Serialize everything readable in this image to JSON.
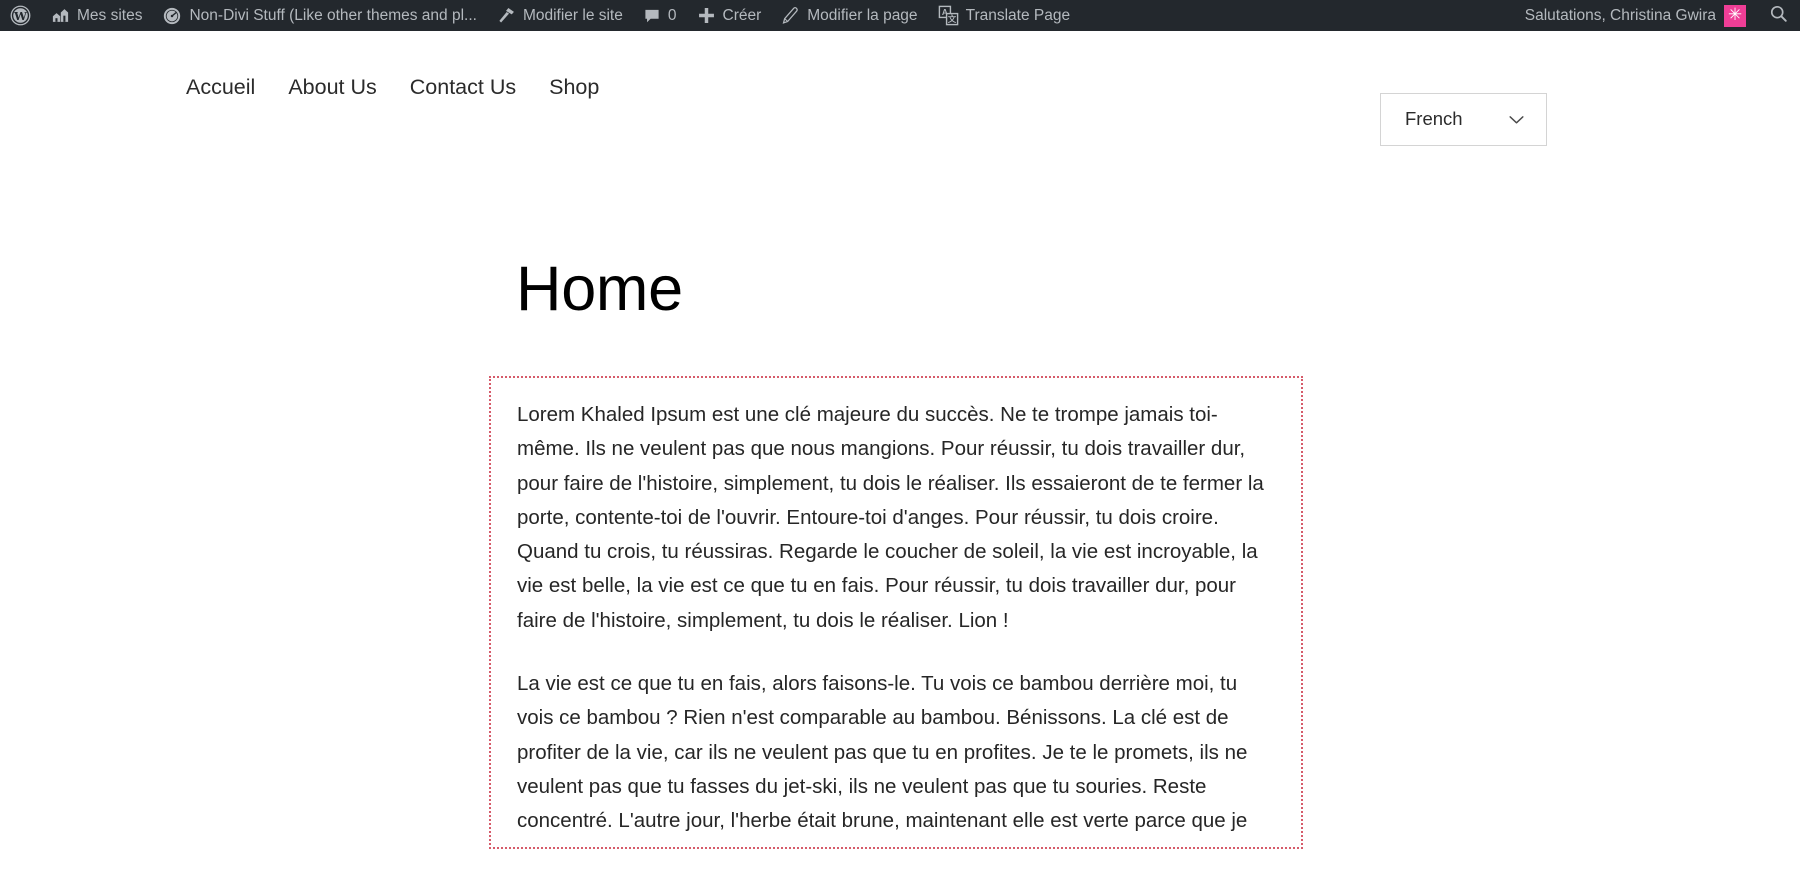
{
  "admin_bar": {
    "items": [
      {
        "name": "wp-logo",
        "icon": "wordpress-icon",
        "label": ""
      },
      {
        "name": "my-sites",
        "icon": "buildings-icon",
        "label": "Mes sites"
      },
      {
        "name": "site-name",
        "icon": "dashboard-icon",
        "label": "Non-Divi Stuff (Like other themes and pl..."
      },
      {
        "name": "customize",
        "icon": "hammer-icon",
        "label": "Modifier le site"
      },
      {
        "name": "comments",
        "icon": "comment-bubble-icon",
        "label": "0"
      },
      {
        "name": "new-content",
        "icon": "plus-icon",
        "label": "Créer"
      },
      {
        "name": "edit-page",
        "icon": "pencil-icon",
        "label": "Modifier la page"
      },
      {
        "name": "translate-page",
        "icon": "translate-icon",
        "label": "Translate Page"
      }
    ],
    "greeting": "Salutations, Christina Gwira",
    "avatar_glyph": "✳",
    "avatar_color": "#ef3e96",
    "search_icon": "search-icon",
    "background_color": "#23282d",
    "text_color": "#b4b9be"
  },
  "site_header": {
    "nav": [
      {
        "label": "Accueil"
      },
      {
        "label": "About Us"
      },
      {
        "label": "Contact Us"
      },
      {
        "label": "Shop"
      }
    ],
    "language_switcher": {
      "selected": "French",
      "chevron_icon": "chevron-down-icon",
      "options": [
        "French"
      ]
    }
  },
  "page": {
    "title": "Home",
    "content_border_color": "#d65b6a",
    "paragraphs": [
      "Lorem Khaled Ipsum est une clé majeure du succès. Ne te trompe jamais toi-même. Ils ne veulent pas que nous mangions. Pour réussir, tu dois travailler dur, pour faire de l'histoire, simplement, tu dois le réaliser. Ils essaieront de te fermer la porte, contente-toi de l'ouvrir. Entoure-toi d'anges. Pour réussir, tu dois croire. Quand tu crois, tu réussiras. Regarde le coucher de soleil, la vie est incroyable, la vie est belle, la vie est ce que tu en fais. Pour réussir, tu dois travailler dur, pour faire de l'histoire, simplement, tu dois le réaliser. Lion !",
      "La vie est ce que tu en fais, alors faisons-le. Tu vois ce bambou derrière moi, tu vois ce bambou ? Rien n'est comparable au bambou. Bénissons. La clé est de profiter de la vie, car ils ne veulent pas que tu en profites. Je te le promets, ils ne veulent pas que tu fasses du jet-ski, ils ne veulent pas que tu souries. Reste concentré. L'autre jour, l'herbe était brune, maintenant elle est verte parce que je"
    ]
  }
}
